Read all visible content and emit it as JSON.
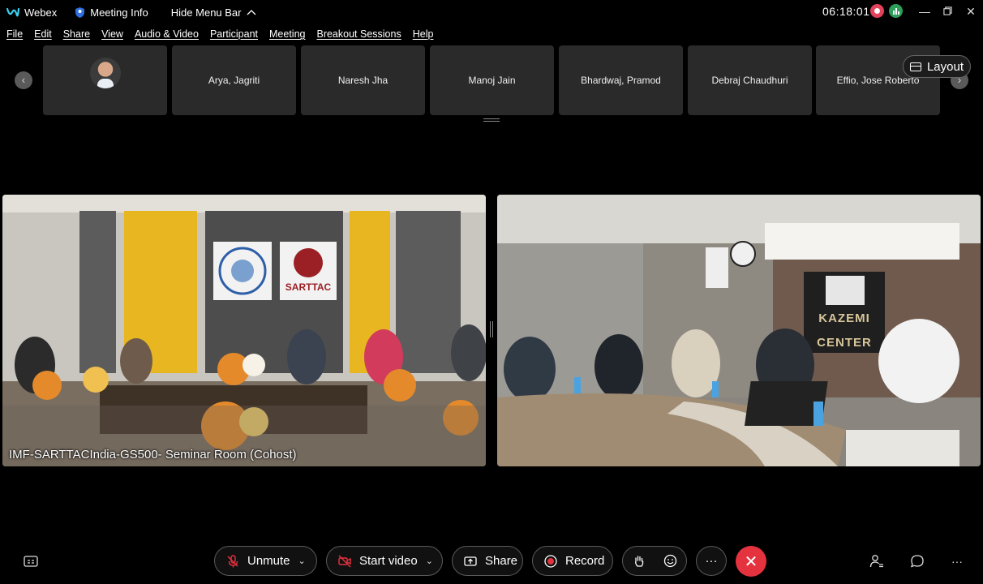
{
  "titlebar": {
    "app_name": "Webex",
    "meeting_info_label": "Meeting Info",
    "hide_menu_label": "Hide Menu Bar",
    "time": "06:18:01"
  },
  "menu": [
    "File",
    "Edit",
    "Share",
    "View",
    "Audio & Video",
    "Participant",
    "Meeting",
    "Breakout Sessions",
    "Help"
  ],
  "participants": [
    "",
    "Arya, Jagriti",
    "Naresh Jha",
    "Manoj Jain",
    "Bhardwaj, Pramod",
    "Debraj Chaudhuri",
    "Effio, Jose Roberto"
  ],
  "layout_label": "Layout",
  "videos": {
    "left_label": "IMF-SARTTACIndia-GS500- Seminar Room (Cohost)",
    "left_sign_1": "INTERNATIONAL MONETARY FUND",
    "left_sign_2": "SARTTAC",
    "right_sign_1": "KAZEMI",
    "right_sign_2": "CENTER"
  },
  "toolbar": {
    "unmute": "Unmute",
    "start_video": "Start video",
    "share": "Share",
    "record": "Record",
    "more": "···"
  },
  "colors": {
    "end_call": "#e5323f",
    "record_indicator": "#e2425a",
    "stats_indicator": "#2e9e5b",
    "tile_bg": "#2a2a2a"
  }
}
